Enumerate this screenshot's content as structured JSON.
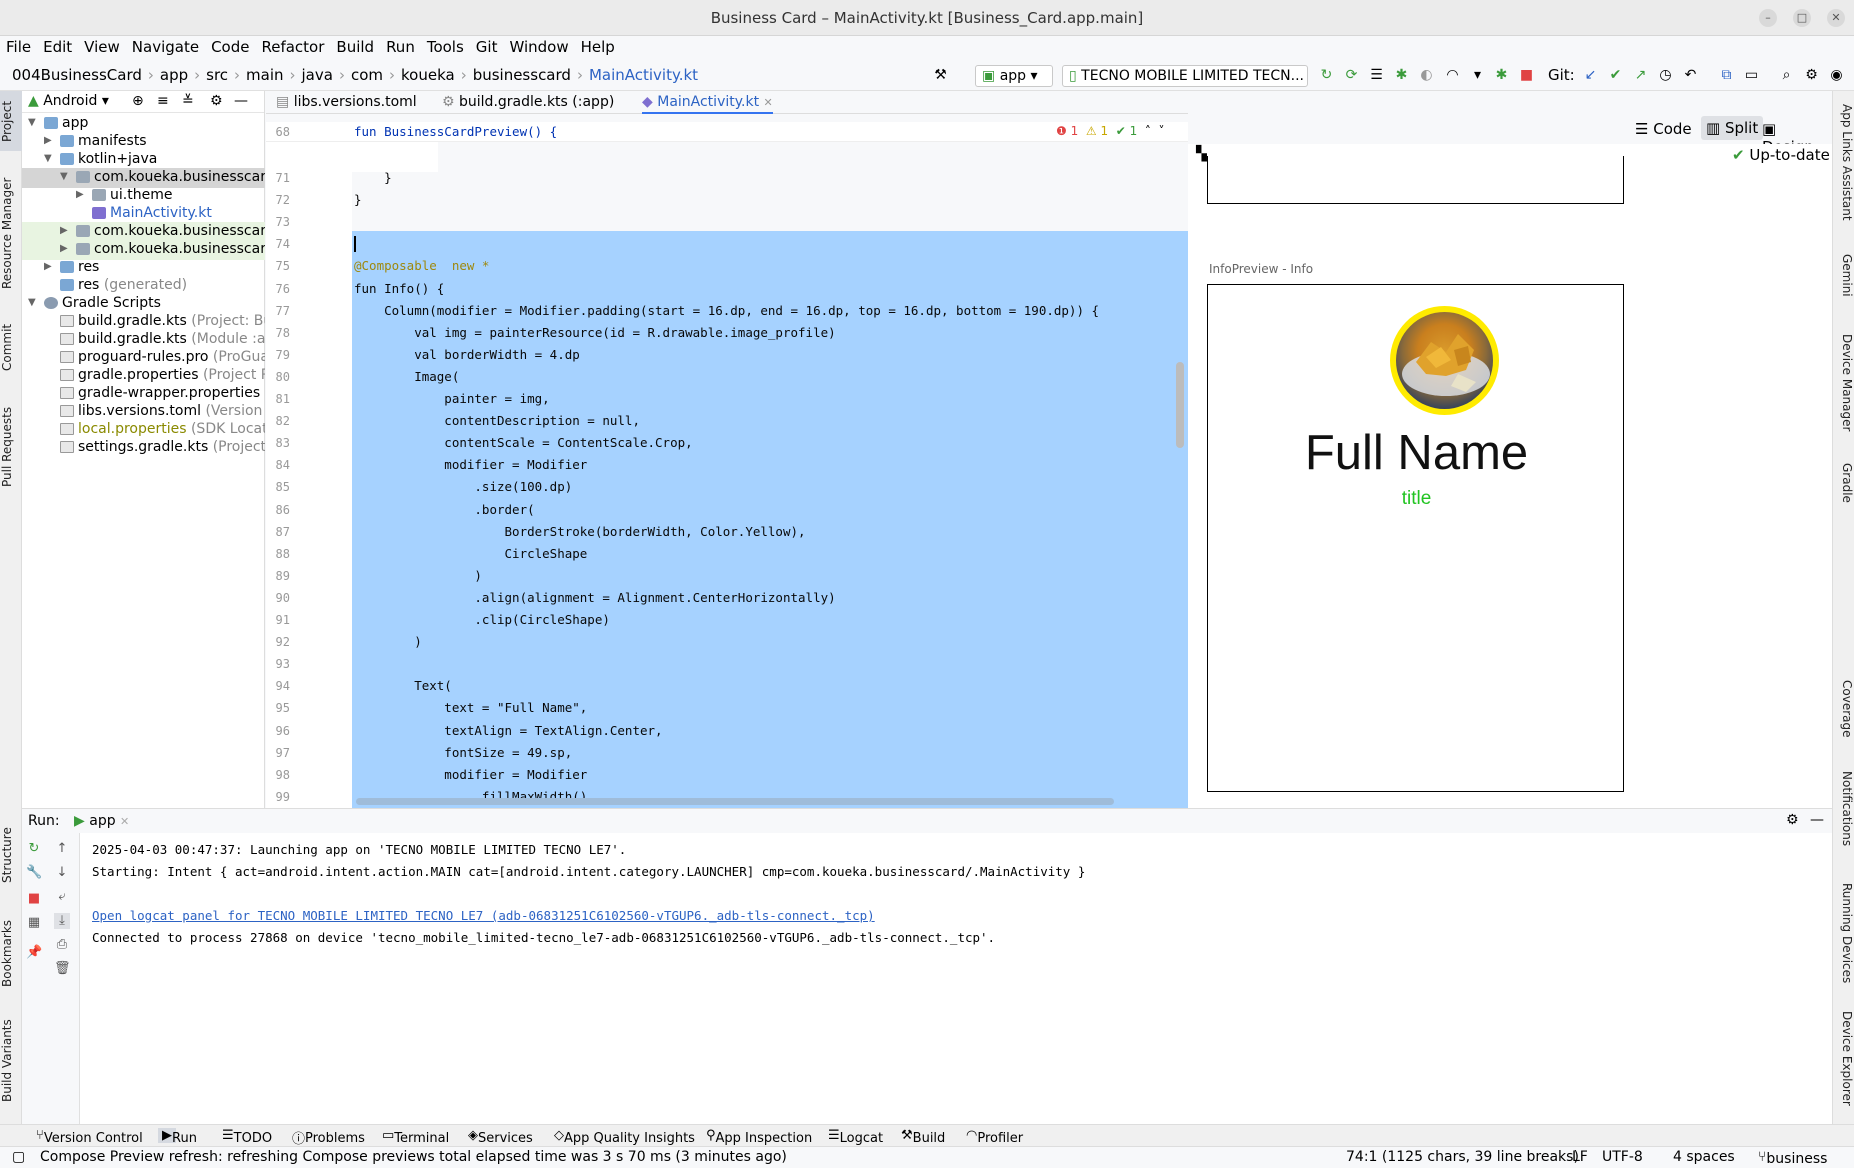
{
  "window": {
    "title": "Business Card – MainActivity.kt [Business_Card.app.main]"
  },
  "menu": [
    "File",
    "Edit",
    "View",
    "Navigate",
    "Code",
    "Refactor",
    "Build",
    "Run",
    "Tools",
    "Git",
    "Window",
    "Help"
  ],
  "breadcrumb": [
    "004BusinessCard",
    "app",
    "src",
    "main",
    "java",
    "com",
    "koueka",
    "businesscard",
    "MainActivity.kt"
  ],
  "toolbar": {
    "config": "app",
    "device": "TECNO MOBILE LIMITED TECN...",
    "git_label": "Git:"
  },
  "project": {
    "view_label": "Android",
    "tree": [
      {
        "label": "app",
        "note": ""
      },
      {
        "label": "manifests",
        "note": ""
      },
      {
        "label": "kotlin+java",
        "note": ""
      },
      {
        "label": "com.koueka.businesscard",
        "note": ""
      },
      {
        "label": "ui.theme",
        "note": ""
      },
      {
        "label": "MainActivity.kt",
        "note": ""
      },
      {
        "label": "com.koueka.businesscard",
        "note": ""
      },
      {
        "label": "com.koueka.businesscard",
        "note": ""
      },
      {
        "label": "res",
        "note": ""
      },
      {
        "label": "res",
        "note": "(generated)"
      },
      {
        "label": "Gradle Scripts",
        "note": ""
      },
      {
        "label": "build.gradle.kts",
        "note": "(Project: Bu"
      },
      {
        "label": "build.gradle.kts",
        "note": "(Module :ap"
      },
      {
        "label": "proguard-rules.pro",
        "note": "(ProGua"
      },
      {
        "label": "gradle.properties",
        "note": "(Project P"
      },
      {
        "label": "gradle-wrapper.properties",
        "note": ""
      },
      {
        "label": "libs.versions.toml",
        "note": "(Version C"
      },
      {
        "label": "local.properties",
        "note": "(SDK Locat"
      },
      {
        "label": "settings.gradle.kts",
        "note": "(Project"
      }
    ]
  },
  "tabs": [
    "libs.versions.toml",
    "build.gradle.kts (:app)",
    "MainActivity.kt"
  ],
  "editor": {
    "header_line": "68",
    "header_code": "fun BusinessCardPreview() {",
    "inspections": {
      "errors": "1",
      "warnings": "1",
      "ok": "1"
    },
    "line_numbers": [
      "71",
      "72",
      "73",
      "74",
      "75",
      "76",
      "77",
      "78",
      "79",
      "80",
      "81",
      "82",
      "83",
      "84",
      "85",
      "86",
      "87",
      "88",
      "89",
      "90",
      "91",
      "92",
      "93",
      "94",
      "95",
      "96",
      "97",
      "98",
      "99"
    ],
    "code_lines": [
      "    }",
      "}",
      "",
      "",
      "@Composable  new *",
      "fun Info() {",
      "    Column(modifier = Modifier.padding(start = 16.dp, end = 16.dp, top = 16.dp, bottom = 190.dp)) {",
      "        val img = painterResource(id = R.drawable.image_profile)",
      "        val borderWidth = 4.dp",
      "        Image(",
      "            painter = img,",
      "            contentDescription = null,",
      "            contentScale = ContentScale.Crop,",
      "            modifier = Modifier",
      "                .size(100.dp)",
      "                .border(",
      "                    BorderStroke(borderWidth, Color.Yellow),",
      "                    CircleShape",
      "                )",
      "                .align(alignment = Alignment.CenterHorizontally)",
      "                .clip(CircleShape)",
      "        )",
      "",
      "        Text(",
      "            text = \"Full Name\",",
      "            textAlign = TextAlign.Center,",
      "            fontSize = 49.sp,",
      "            modifier = Modifier",
      "                .fillMaxWidth()"
    ]
  },
  "view_modes": {
    "code": "Code",
    "split": "Split",
    "design": "Design",
    "status": "Up-to-date"
  },
  "preview": {
    "label": "InfoPreview - Info",
    "name": "Full Name",
    "title": "title",
    "accent": "#ffeb00",
    "title_color": "#22c422"
  },
  "run": {
    "label": "Run:",
    "tab": "app",
    "lines": [
      "2025-04-03 00:47:37: Launching app on 'TECNO MOBILE LIMITED TECNO LE7'.",
      "Starting: Intent { act=android.intent.action.MAIN cat=[android.intent.category.LAUNCHER] cmp=com.koueka.businesscard/.MainActivity }",
      "",
      "Open logcat panel for TECNO MOBILE LIMITED TECNO LE7 (adb-06831251C6102560-vTGUP6._adb-tls-connect._tcp)",
      "Connected to process 27868 on device 'tecno_mobile_limited-tecno_le7-adb-06831251C6102560-vTGUP6._adb-tls-connect._tcp'."
    ]
  },
  "left_tools": [
    "Project",
    "Resource Manager",
    "Commit",
    "Pull Requests",
    "Structure",
    "Bookmarks",
    "Build Variants"
  ],
  "right_tools": [
    "App Links Assistant",
    "Gemini",
    "Device Manager",
    "Gradle",
    "Coverage",
    "Notifications",
    "Running Devices",
    "Device Explorer"
  ],
  "bottom_tools": [
    "Version Control",
    "Run",
    "TODO",
    "Problems",
    "Terminal",
    "Services",
    "App Quality Insights",
    "App Inspection",
    "Logcat",
    "Build",
    "Profiler"
  ],
  "status": {
    "message": "Compose Preview refresh: refreshing Compose previews total elapsed time was 3 s 70 ms (3 minutes ago)",
    "position": "74:1 (1125 chars, 39 line breaks)",
    "line_sep": "LF",
    "encoding": "UTF-8",
    "indent": "4 spaces",
    "branch": "business"
  }
}
